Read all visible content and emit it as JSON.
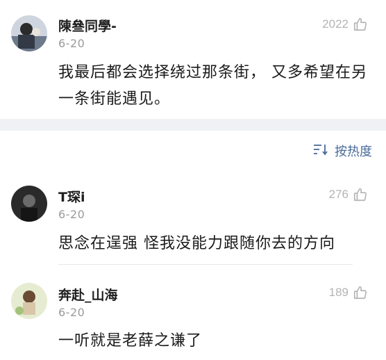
{
  "comments": [
    {
      "name": "陳叄同學-",
      "date": "6-20",
      "likes": "2022",
      "text": "我最后都会选择绕过那条街， 又多希望在另一条街能遇见。"
    },
    {
      "name": "T琛i",
      "date": "6-20",
      "likes": "276",
      "text": "思念在逞强 怪我没能力跟随你去的方向"
    },
    {
      "name": "奔赴_山海",
      "date": "6-20",
      "likes": "189",
      "text": "一听就是老薛之谦了"
    }
  ],
  "sort": {
    "label": "按热度"
  },
  "colors": {
    "accent": "#496a99",
    "muted": "#9a9a9a",
    "divider_band": "#f0f1f4"
  },
  "icons": {
    "like": "thumbs-up-icon",
    "sort": "sort-icon"
  }
}
